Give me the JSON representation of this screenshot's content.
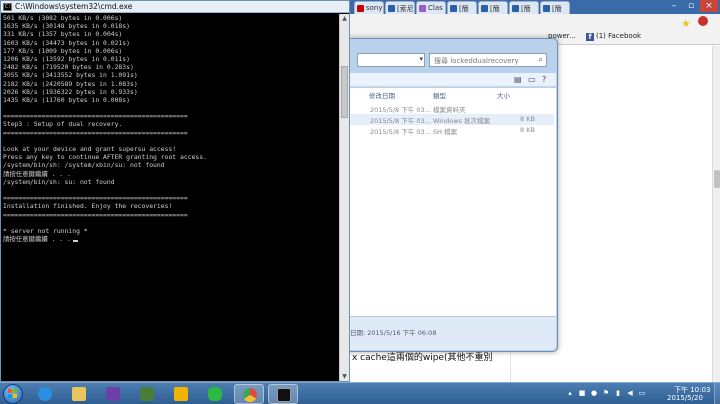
{
  "cmd": {
    "title": "C:\\Windows\\system32\\cmd.exe",
    "lines": [
      "501 KB/s (3082 bytes in 0.006s)",
      "1635 KB/s (30148 bytes in 0.018s)",
      "331 KB/s (1357 bytes in 0.004s)",
      "1603 KB/s (34473 bytes in 0.021s)",
      "177 KB/s (1009 bytes in 0.006s)",
      "1206 KB/s (13592 bytes in 0.011s)",
      "2482 KB/s (719520 bytes in 0.283s)",
      "3055 KB/s (3413552 bytes in 1.091s)",
      "2182 KB/s (2420589 bytes in 1.083s)",
      "2026 KB/s (1936322 bytes in 0.933s)",
      "1435 KB/s (11760 bytes in 0.008s)",
      "",
      "================================================",
      "Step3 : Setup of dual recovery.",
      "================================================",
      "",
      "Look at your device and grant supersu access!",
      "Press any key to continue AFTER granting root access.",
      "/system/bin/sh: /system/xbin/su: not found",
      "請按任意鍵繼續 . . .",
      "/system/bin/sh: su: not found",
      "",
      "================================================",
      "Installation finished. Enjoy the recoveries!",
      "================================================",
      "",
      "* server not running *",
      "請按任意鍵繼續 . . ."
    ]
  },
  "browser": {
    "tabs": [
      {
        "label": "sony",
        "color": "#cc0000"
      },
      {
        "label": "[索尼",
        "color": "#2b5fa6"
      },
      {
        "label": "Clas",
        "color": "#9a5cc6"
      },
      {
        "label": "[簡",
        "color": "#2b5fa6"
      },
      {
        "label": "[簡",
        "color": "#2b5fa6"
      },
      {
        "label": "[簡",
        "color": "#2b5fa6"
      },
      {
        "label": "[簡",
        "color": "#2b5fa6"
      }
    ],
    "bookmarks": [
      {
        "label": "power..."
      },
      {
        "label": "(1) Facebook"
      }
    ],
    "page_snippet": "x cache這兩個的wipe(其他不重別"
  },
  "explorer": {
    "search_placeholder": "搜尋 lockeddualrecovery",
    "columns": {
      "date": "修改日期",
      "type": "類型",
      "size": "大小"
    },
    "rows": [
      {
        "date": "2015/5/8 下午 03...",
        "type": "檔案資料夾",
        "size": ""
      },
      {
        "date": "2015/5/8 下午 03...",
        "type": "Windows 批次檔案",
        "size": "8 KB"
      },
      {
        "date": "2015/5/8 下午 03...",
        "type": "SH 檔案",
        "size": "8 KB"
      }
    ],
    "details_date": "日期: 2015/5/16 下午 06:08"
  },
  "taskbar": {
    "time": "下午 10:03",
    "date": "2015/5/20",
    "apps": [
      {
        "name": "ie",
        "color": "#2a8fe0"
      },
      {
        "name": "explorer",
        "color": "#e9c45a"
      },
      {
        "name": "visual-studio",
        "color": "#6d3fa8"
      },
      {
        "name": "android-sdk",
        "color": "#4a7d3a"
      },
      {
        "name": "pencil-app",
        "color": "#f0b400"
      },
      {
        "name": "line",
        "color": "#2bb843"
      },
      {
        "name": "chrome",
        "color": "#e04a3a"
      },
      {
        "name": "cmd",
        "color": "#111111"
      }
    ]
  }
}
